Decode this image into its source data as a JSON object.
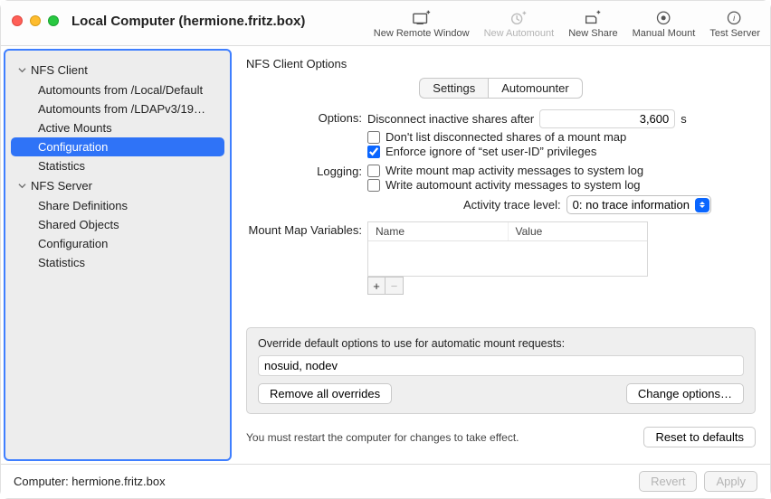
{
  "window": {
    "title": "Local Computer (hermione.fritz.box)"
  },
  "toolbar": {
    "new_remote_window": "New Remote Window",
    "new_automount": "New Automount",
    "new_share": "New Share",
    "manual_mount": "Manual Mount",
    "test_server": "Test Server"
  },
  "sidebar": {
    "groups": [
      {
        "label": "NFS Client",
        "items": [
          "Automounts from /Local/Default",
          "Automounts from /LDAPv3/19…",
          "Active Mounts",
          "Configuration",
          "Statistics"
        ],
        "selected_index": 3
      },
      {
        "label": "NFS Server",
        "items": [
          "Share Definitions",
          "Shared Objects",
          "Configuration",
          "Statistics"
        ]
      }
    ]
  },
  "page": {
    "title": "NFS Client Options",
    "tabs": {
      "settings": "Settings",
      "automounter": "Automounter",
      "active": "automounter"
    },
    "options_label": "Options:",
    "disconnect_label": "Disconnect inactive shares after",
    "disconnect_value": "3,600",
    "disconnect_unit": "s",
    "chk_dont_list": "Don't list disconnected shares of a mount map",
    "chk_enforce": "Enforce ignore of “set user-ID” privileges",
    "logging_label": "Logging:",
    "chk_log_mountmap": "Write mount map activity messages to system log",
    "chk_log_automount": "Write automount activity messages to system log",
    "trace_label": "Activity trace level:",
    "trace_value": "0: no trace information",
    "mmv_label": "Mount Map Variables:",
    "mmv_col_name": "Name",
    "mmv_col_value": "Value",
    "override_title": "Override default options to use for automatic mount requests:",
    "override_value": "nosuid, nodev",
    "btn_remove_overrides": "Remove all overrides",
    "btn_change_options": "Change options…",
    "restart_note": "You must restart the computer for changes to take effect.",
    "btn_reset": "Reset to defaults"
  },
  "footer": {
    "computer_label": "Computer: hermione.fritz.box",
    "btn_revert": "Revert",
    "btn_apply": "Apply"
  }
}
